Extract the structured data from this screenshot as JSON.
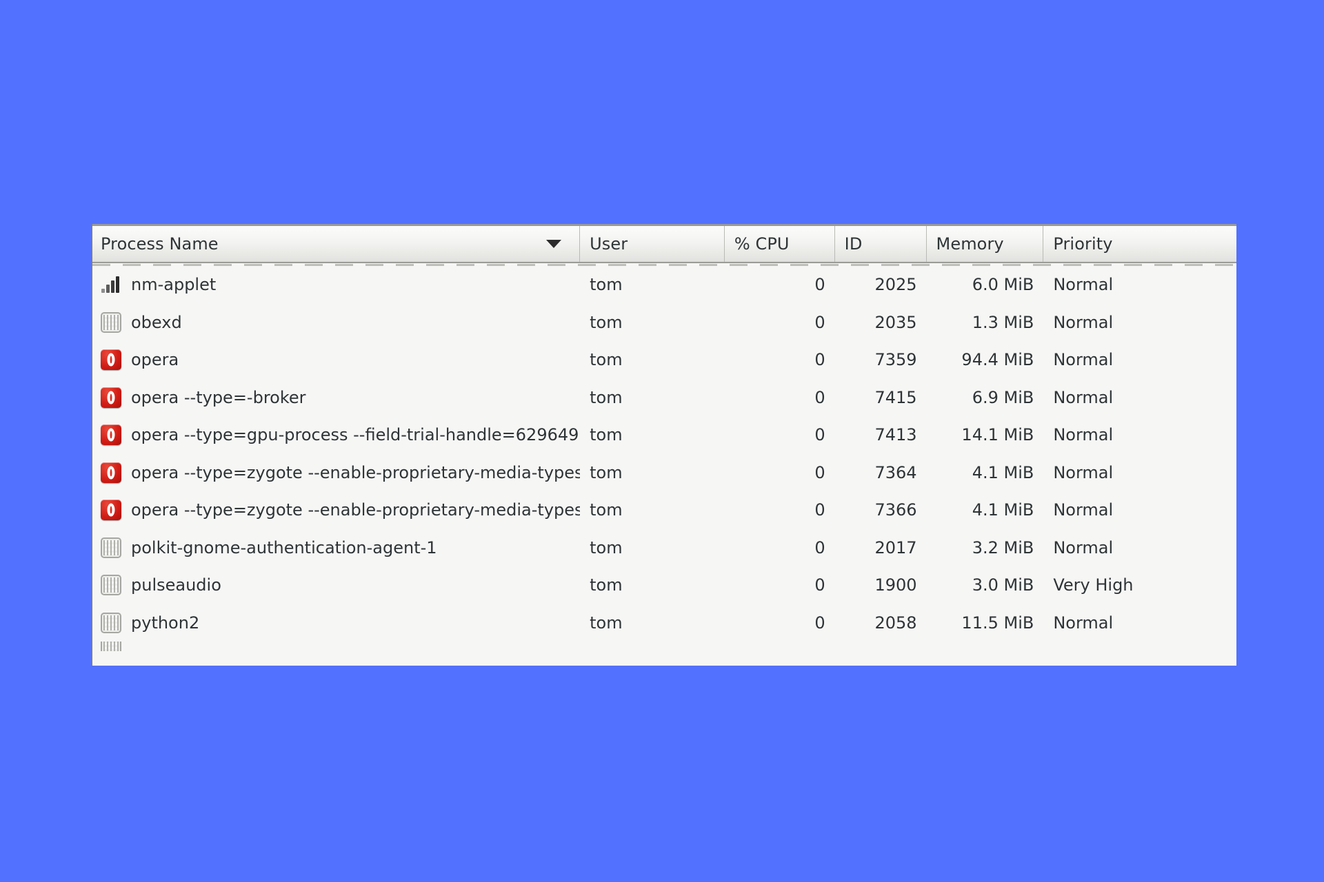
{
  "window": {
    "background_color": "#5271ff",
    "panel_background": "#f6f6f5"
  },
  "table": {
    "columns": [
      {
        "key": "name",
        "label": "Process Name",
        "sorted": true,
        "sort_direction": "descending",
        "align": "left"
      },
      {
        "key": "user",
        "label": "User",
        "sorted": false,
        "align": "left"
      },
      {
        "key": "cpu",
        "label": "% CPU",
        "sorted": false,
        "align": "right"
      },
      {
        "key": "id",
        "label": "ID",
        "sorted": false,
        "align": "right"
      },
      {
        "key": "memory",
        "label": "Memory",
        "sorted": false,
        "align": "right"
      },
      {
        "key": "priority",
        "label": "Priority",
        "sorted": false,
        "align": "left"
      }
    ],
    "rows": [
      {
        "icon": "signal-bars-icon",
        "name": "nm-applet",
        "user": "tom",
        "cpu": "0",
        "id": "2025",
        "memory": "6.0 MiB",
        "priority": "Normal"
      },
      {
        "icon": "binary-icon",
        "name": "obexd",
        "user": "tom",
        "cpu": "0",
        "id": "2035",
        "memory": "1.3 MiB",
        "priority": "Normal"
      },
      {
        "icon": "opera-icon",
        "name": "opera",
        "user": "tom",
        "cpu": "0",
        "id": "7359",
        "memory": "94.4 MiB",
        "priority": "Normal"
      },
      {
        "icon": "opera-icon",
        "name": "opera --type=-broker",
        "user": "tom",
        "cpu": "0",
        "id": "7415",
        "memory": "6.9 MiB",
        "priority": "Normal"
      },
      {
        "icon": "opera-icon",
        "name": "opera --type=gpu-process --field-trial-handle=629649",
        "user": "tom",
        "cpu": "0",
        "id": "7413",
        "memory": "14.1 MiB",
        "priority": "Normal"
      },
      {
        "icon": "opera-icon",
        "name": "opera --type=zygote --enable-proprietary-media-types",
        "user": "tom",
        "cpu": "0",
        "id": "7364",
        "memory": "4.1 MiB",
        "priority": "Normal"
      },
      {
        "icon": "opera-icon",
        "name": "opera --type=zygote --enable-proprietary-media-types",
        "user": "tom",
        "cpu": "0",
        "id": "7366",
        "memory": "4.1 MiB",
        "priority": "Normal"
      },
      {
        "icon": "binary-icon",
        "name": "polkit-gnome-authentication-agent-1",
        "user": "tom",
        "cpu": "0",
        "id": "2017",
        "memory": "3.2 MiB",
        "priority": "Normal"
      },
      {
        "icon": "binary-icon",
        "name": "pulseaudio",
        "user": "tom",
        "cpu": "0",
        "id": "1900",
        "memory": "3.0 MiB",
        "priority": "Very High"
      },
      {
        "icon": "binary-icon",
        "name": "python2",
        "user": "tom",
        "cpu": "0",
        "id": "2058",
        "memory": "11.5 MiB",
        "priority": "Normal"
      }
    ]
  }
}
